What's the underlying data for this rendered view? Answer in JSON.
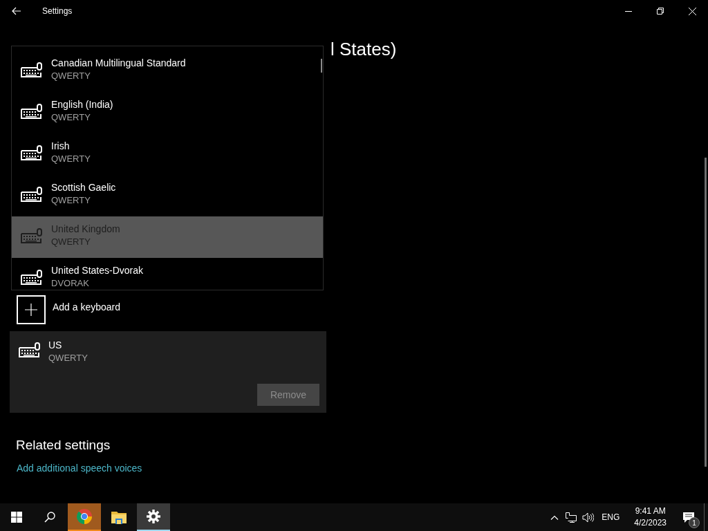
{
  "window": {
    "title": "Settings"
  },
  "heading": {
    "visible_text": "l States)"
  },
  "dropdown": {
    "items": [
      {
        "name": "Canadian Multilingual Standard",
        "layout": "QWERTY",
        "selected": false
      },
      {
        "name": "English (India)",
        "layout": "QWERTY",
        "selected": false
      },
      {
        "name": "Irish",
        "layout": "QWERTY",
        "selected": false
      },
      {
        "name": "Scottish Gaelic",
        "layout": "QWERTY",
        "selected": false
      },
      {
        "name": "United Kingdom",
        "layout": "QWERTY",
        "selected": true
      },
      {
        "name": "United States-Dvorak",
        "layout": "DVORAK",
        "selected": false
      }
    ]
  },
  "add_keyboard": {
    "label": "Add a keyboard"
  },
  "installed_keyboards": [
    {
      "name": "US",
      "layout": "QWERTY"
    }
  ],
  "remove_button": {
    "label": "Remove",
    "disabled": true
  },
  "related_settings": {
    "title": "Related settings",
    "links": [
      "Add additional speech voices"
    ]
  },
  "taskbar": {
    "apps": [
      {
        "kind": "browser",
        "selected": false,
        "flashing": true
      },
      {
        "kind": "folder",
        "selected": false,
        "flashing": false
      },
      {
        "kind": "settings",
        "selected": true,
        "flashing": false
      }
    ],
    "language": "ENG",
    "time": "9:41 AM",
    "date": "4/2/2023",
    "notification_count": "1"
  }
}
